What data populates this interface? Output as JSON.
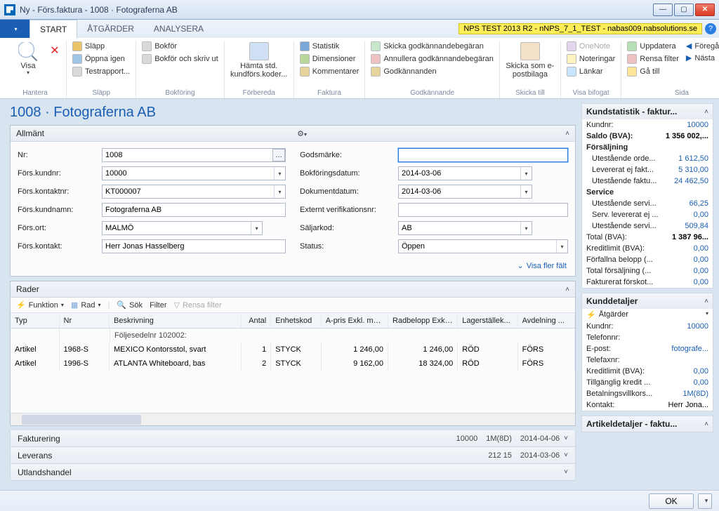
{
  "window": {
    "title": "Ny - Förs.faktura - 1008 · Fotograferna AB"
  },
  "env_badge": "NPS TEST 2013 R2 - nNPS_7_1_TEST - nabas009.nabsolutions.se",
  "tabs": {
    "file": "",
    "start": "START",
    "atgarder": "ÅTGÄRDER",
    "analysera": "ANALYSERA"
  },
  "ribbon": {
    "hantera": {
      "label": "Hantera",
      "visa": "Visa"
    },
    "slapp_grp": {
      "label": "Släpp",
      "slapp": "Släpp",
      "oppna": "Öppna igen",
      "testrapport": "Testrapport..."
    },
    "bokforing": {
      "label": "Bokföring",
      "bokfor": "Bokför",
      "bokfor_skriv": "Bokför och skriv ut"
    },
    "forbereda": {
      "label": "Förbereda",
      "hamta": "Hämta std. kundförs.koder..."
    },
    "faktura": {
      "label": "Faktura",
      "statistik": "Statistik",
      "dimensioner": "Dimensioner",
      "kommentarer": "Kommentarer"
    },
    "godk": {
      "label": "Godkännande",
      "skicka": "Skicka godkännandebegäran",
      "annullera": "Annullera godkännandebegäran",
      "godkannanden": "Godkännanden"
    },
    "skicka_till": {
      "label": "Skicka till",
      "ebilaga": "Skicka som e-postbilaga"
    },
    "visa_bifogat": {
      "label": "Visa bifogat",
      "onenote": "OneNote",
      "noteringar": "Noteringar",
      "lankar": "Länkar"
    },
    "sida": {
      "label": "Sida",
      "uppdatera": "Uppdatera",
      "rensa": "Rensa filter",
      "gatill": "Gå till",
      "foregaende": "Föregående",
      "nasta": "Nästa"
    }
  },
  "page_title_no": "1008",
  "page_title_name": "Fotograferna AB",
  "fasttabs": {
    "allmant": "Allmänt",
    "rader": "Rader",
    "fakturering": "Fakturering",
    "leverans": "Leverans",
    "utlandshandel": "Utlandshandel"
  },
  "fields": {
    "left": {
      "nr_l": "Nr:",
      "nr_v": "1008",
      "fkundnr_l": "Förs.kundnr:",
      "fkundnr_v": "10000",
      "fkontaktnr_l": "Förs.kontaktnr:",
      "fkontaktnr_v": "KT000007",
      "fkundnamn_l": "Förs.kundnamn:",
      "fkundnamn_v": "Fotograferna AB",
      "fort_l": "Förs.ort:",
      "fort_v": "MALMÖ",
      "fkontakt_l": "Förs.kontakt:",
      "fkontakt_v": "Herr Jonas Hasselberg"
    },
    "right": {
      "godsm_l": "Godsmärke:",
      "godsm_v": "",
      "bokfd_l": "Bokföringsdatum:",
      "bokfd_v": "2014-03-06",
      "dokd_l": "Dokumentdatum:",
      "dokd_v": "2014-03-06",
      "extver_l": "Externt verifikationsnr:",
      "extver_v": "",
      "salj_l": "Säljarkod:",
      "salj_v": "AB",
      "status_l": "Status:",
      "status_v": "Öppen"
    },
    "more": "Visa fler fält"
  },
  "rader_toolbar": {
    "funktion": "Funktion",
    "rad": "Rad",
    "sok": "Sök",
    "filter": "Filter",
    "rensa": "Rensa filter"
  },
  "grid": {
    "headers": {
      "typ": "Typ",
      "nr": "Nr",
      "besk": "Beskrivning",
      "antal": "Antal",
      "enh": "Enhetskod",
      "pris": "A-pris Exkl. mo...",
      "rad": "Radbelopp Exkl....",
      "lag": "Lagerställek...",
      "avd": "Avdelning ..."
    },
    "group": "Följesedelnr 102002:",
    "rows": [
      {
        "typ": "Artikel",
        "nr": "1968-S",
        "besk": "MEXICO Kontorsstol, svart",
        "antal": "1",
        "enh": "STYCK",
        "pris": "1 246,00",
        "rad": "1 246,00",
        "lag": "RÖD",
        "avd": "FÖRS"
      },
      {
        "typ": "Artikel",
        "nr": "1996-S",
        "besk": "ATLANTA Whiteboard, bas",
        "antal": "2",
        "enh": "STYCK",
        "pris": "9 162,00",
        "rad": "18 324,00",
        "lag": "RÖD",
        "avd": "FÖRS"
      }
    ]
  },
  "fakt_summary": {
    "a": "10000",
    "b": "1M(8D)",
    "c": "2014-04-06"
  },
  "lev_summary": {
    "a": "212 15",
    "b": "2014-03-06"
  },
  "fb_stat": {
    "title": "Kundstatistik - faktur...",
    "kundnr_l": "Kundnr:",
    "kundnr_v": "10000",
    "saldo_l": "Saldo (BVA):",
    "saldo_v": "1 356 002,...",
    "sec1": "Försäljning",
    "uo_l": "Utestående orde...",
    "uo_v": "1 612,50",
    "lef_l": "Levererat ej fakt...",
    "lef_v": "5 310,00",
    "uf_l": "Utestående faktu...",
    "uf_v": "24 462,50",
    "sec2": "Service",
    "us1_l": "Utestående servi...",
    "us1_v": "66,25",
    "sle_l": "Serv. levererat ej ...",
    "sle_v": "0,00",
    "us2_l": "Utestående servi...",
    "us2_v": "509,84",
    "tot_l": "Total (BVA):",
    "tot_v": "1 387 96...",
    "kl_l": "Kreditlimit (BVA):",
    "kl_v": "0,00",
    "ff_l": "Förfallna belopp (...",
    "ff_v": "0,00",
    "tf_l": "Total försäljning (...",
    "tf_v": "0,00",
    "ff2_l": "Fakturerat förskot...",
    "ff2_v": "0,00"
  },
  "fb_det": {
    "title": "Kunddetaljer",
    "atg": "Åtgärder",
    "kundnr_l": "Kundnr:",
    "kundnr_v": "10000",
    "tel_l": "Telefonnr:",
    "tel_v": "",
    "ep_l": "E-post:",
    "ep_v": "fotografe...",
    "fax_l": "Telefaxnr:",
    "fax_v": "",
    "kl_l": "Kreditlimit (BVA):",
    "kl_v": "0,00",
    "tk_l": "Tillgänglig kredit ...",
    "tk_v": "0,00",
    "bv_l": "Betalningsvillkors...",
    "bv_v": "1M(8D)",
    "kon_l": "Kontakt:",
    "kon_v": "Herr Jona..."
  },
  "fb_art": {
    "title": "Artikeldetaljer - faktu..."
  },
  "footer": {
    "ok": "OK"
  }
}
